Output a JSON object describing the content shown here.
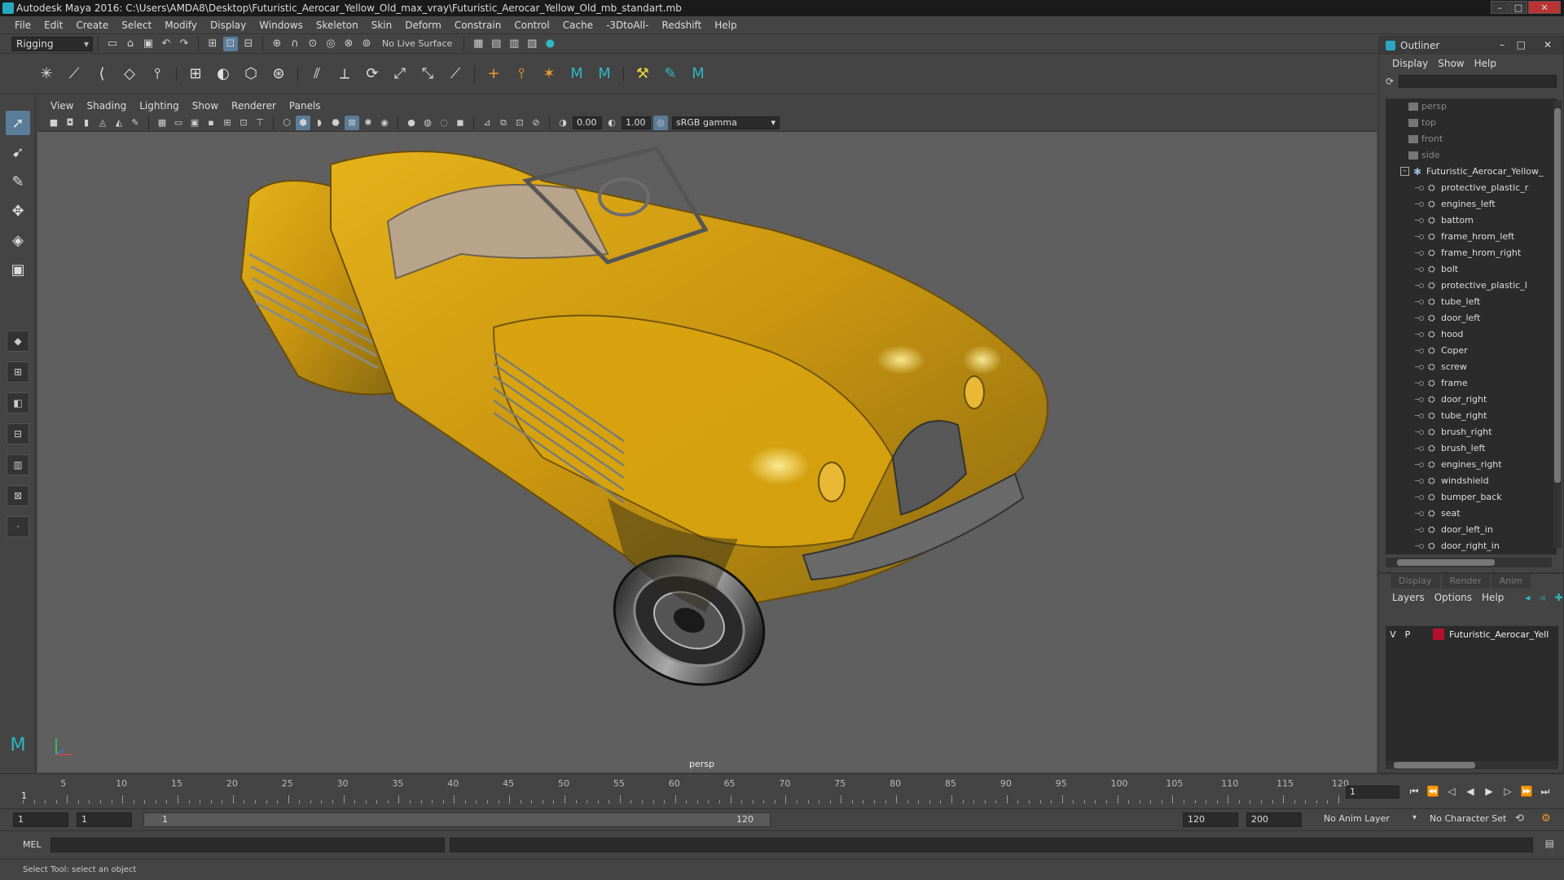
{
  "window": {
    "title": "Autodesk Maya 2016: C:\\Users\\AMDA8\\Desktop\\Futuristic_Aerocar_Yellow_Old_max_vray\\Futuristic_Aerocar_Yellow_Old_mb_standart.mb",
    "minimize": "–",
    "maximize": "□",
    "close": "✕"
  },
  "menubar": [
    "File",
    "Edit",
    "Create",
    "Select",
    "Modify",
    "Display",
    "Windows",
    "Skeleton",
    "Skin",
    "Deform",
    "Constrain",
    "Control",
    "Cache",
    "-3DtoAll-",
    "Redshift",
    "Help"
  ],
  "status_line": {
    "mode": "Rigging",
    "live_surface": "No Live Surface"
  },
  "viewport": {
    "menus": [
      "View",
      "Shading",
      "Lighting",
      "Show",
      "Renderer",
      "Panels"
    ],
    "exposure": "0.00",
    "gamma": "1.00",
    "color_space": "sRGB gamma",
    "camera_label": "persp"
  },
  "outliner": {
    "title": "Outliner",
    "menus": [
      "Display",
      "Show",
      "Help"
    ],
    "cameras": [
      "persp",
      "top",
      "front",
      "side"
    ],
    "group": "Futuristic_Aerocar_Yellow_",
    "items": [
      "protective_plastic_r",
      "engines_left",
      "battom",
      "frame_hrom_left",
      "frame_hrom_right",
      "bolt",
      "protective_plastic_l",
      "tube_left",
      "door_left",
      "hood",
      "Coper",
      "screw",
      "frame",
      "door_right",
      "tube_right",
      "brush_right",
      "brush_left",
      "engines_right",
      "windshield",
      "bumper_back",
      "seat",
      "door_left_in",
      "door_right_in"
    ]
  },
  "layers": {
    "tabs": [
      "Display",
      "Render",
      "Anim"
    ],
    "menus": [
      "Layers",
      "Options",
      "Help"
    ],
    "rows": [
      {
        "v": "V",
        "p": "P",
        "color": "#b3112e",
        "name": "Futuristic_Aerocar_Yell"
      }
    ]
  },
  "timeline": {
    "ticks": [
      5,
      10,
      15,
      20,
      25,
      30,
      35,
      40,
      45,
      50,
      55,
      60,
      65,
      70,
      75,
      80,
      85,
      90,
      95,
      100,
      105,
      110,
      115,
      120
    ],
    "start_label": "1",
    "min": 1,
    "max": 120,
    "current_frame": "1"
  },
  "range": {
    "start": "1",
    "playback_start": "1",
    "bar_start": "1",
    "bar_end": "120",
    "playback_end": "120",
    "end": "200",
    "anim_layer": "No Anim Layer",
    "character_set": "No Character Set"
  },
  "command_line": {
    "label": "MEL"
  },
  "help_line": "Select Tool: select an object",
  "colors": {
    "accent": "#5a7d9a",
    "maya_teal": "#2fb7c2",
    "car_yellow": "#d9a40e"
  }
}
